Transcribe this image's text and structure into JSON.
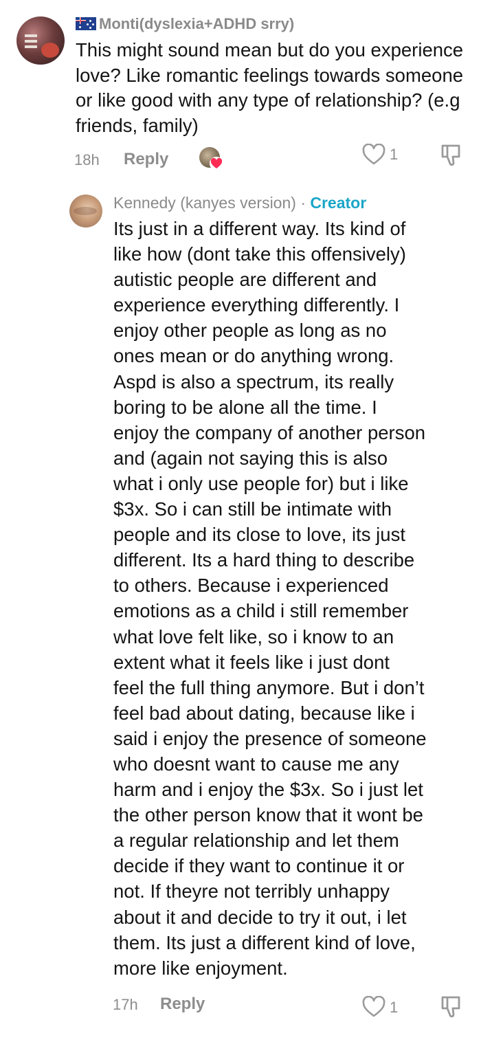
{
  "comments": [
    {
      "username": "Monti(dyslexia+ADHD srry)",
      "flag_icon": "australia-flag-icon",
      "text": "This might sound mean but do you experience love? Like romantic feelings towards someone or like good with any type of relationship? (e.g friends, family)",
      "time": "18h",
      "reply_label": "Reply",
      "like_count": "1"
    },
    {
      "username": "Kennedy (kanyes version)",
      "separator": "·",
      "creator_badge": "Creator",
      "lines": [
        "Its just in a different way. Its kind of",
        "like how (dont take this offensively)",
        "autistic people are different and",
        "experience everything differently. I",
        "enjoy other people as long as no",
        "ones mean or do anything wrong.",
        "Aspd is also a spectrum, its really",
        "boring to be alone all the time. I",
        "enjoy the company of another person",
        "and (again not saying this is also",
        "what i only use people for) but i like",
        "$3x. So i can still be intimate with",
        "people and its close to love, its just",
        "different. Its a hard thing to describe",
        "to others. Because i experienced",
        "emotions as a child i still remember",
        "what love felt like, so i know to an",
        "extent what it feels like i just dont",
        "feel the full thing anymore. But i don’t",
        "feel bad about dating, because like i",
        "said i enjoy the presence of someone",
        "who doesnt want to cause me any",
        "harm and i enjoy the $3x. So i just let",
        "the other person know that it wont be",
        "a regular relationship and let them",
        "decide if they want to continue it or",
        "not. If theyre not terribly unhappy",
        "about it and decide to try it out, i let",
        "them. Its just a different kind of love,",
        "more like enjoyment."
      ],
      "time": "17h",
      "reply_label": "Reply",
      "like_count": "1"
    }
  ],
  "colors": {
    "creator_badge": "#1aa6c8",
    "liked_heart": "#fe2c55",
    "muted_text": "#8d8d8d"
  }
}
